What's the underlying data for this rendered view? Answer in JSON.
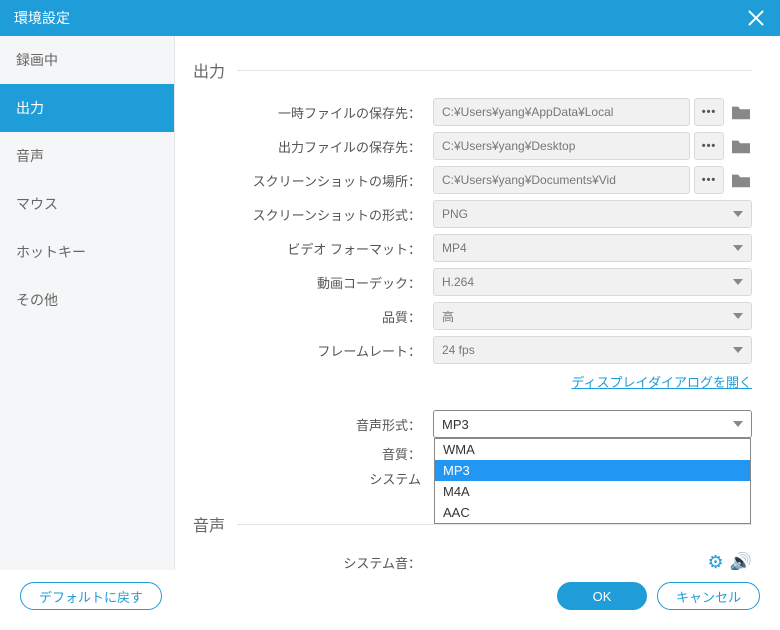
{
  "titlebar": {
    "title": "環境設定"
  },
  "sidebar": {
    "items": [
      {
        "label": "録画中"
      },
      {
        "label": "出力"
      },
      {
        "label": "音声"
      },
      {
        "label": "マウス"
      },
      {
        "label": "ホットキー"
      },
      {
        "label": "その他"
      }
    ],
    "active_index": 1
  },
  "output": {
    "section_title": "出力",
    "rows": {
      "temp_path": {
        "label": "一時ファイルの保存先：",
        "value": "C:¥Users¥yang¥AppData¥Local"
      },
      "output_path": {
        "label": "出力ファイルの保存先：",
        "value": "C:¥Users¥yang¥Desktop"
      },
      "screenshot_path": {
        "label": "スクリーンショットの場所：",
        "value": "C:¥Users¥yang¥Documents¥Vid"
      },
      "screenshot_format": {
        "label": "スクリーンショットの形式：",
        "value": "PNG"
      },
      "video_format": {
        "label": "ビデオ フォーマット：",
        "value": "MP4"
      },
      "video_codec": {
        "label": "動画コーデック：",
        "value": "H.264"
      },
      "quality": {
        "label": "品質：",
        "value": "高"
      },
      "framerate": {
        "label": "フレームレート：",
        "value": "24 fps"
      }
    },
    "display_dialog_link": "ディスプレイダイアログを開く",
    "audio_format": {
      "label": "音声形式：",
      "value": "MP3",
      "options": [
        "WMA",
        "MP3",
        "M4A",
        "AAC"
      ],
      "selected_index": 1
    },
    "audio_quality_label": "音質：",
    "system_label": "システム",
    "audio_section_title": "音声",
    "system_sound_label": "システム音："
  },
  "footer": {
    "reset_label": "デフォルトに戻す",
    "ok_label": "OK",
    "cancel_label": "キャンセル"
  }
}
